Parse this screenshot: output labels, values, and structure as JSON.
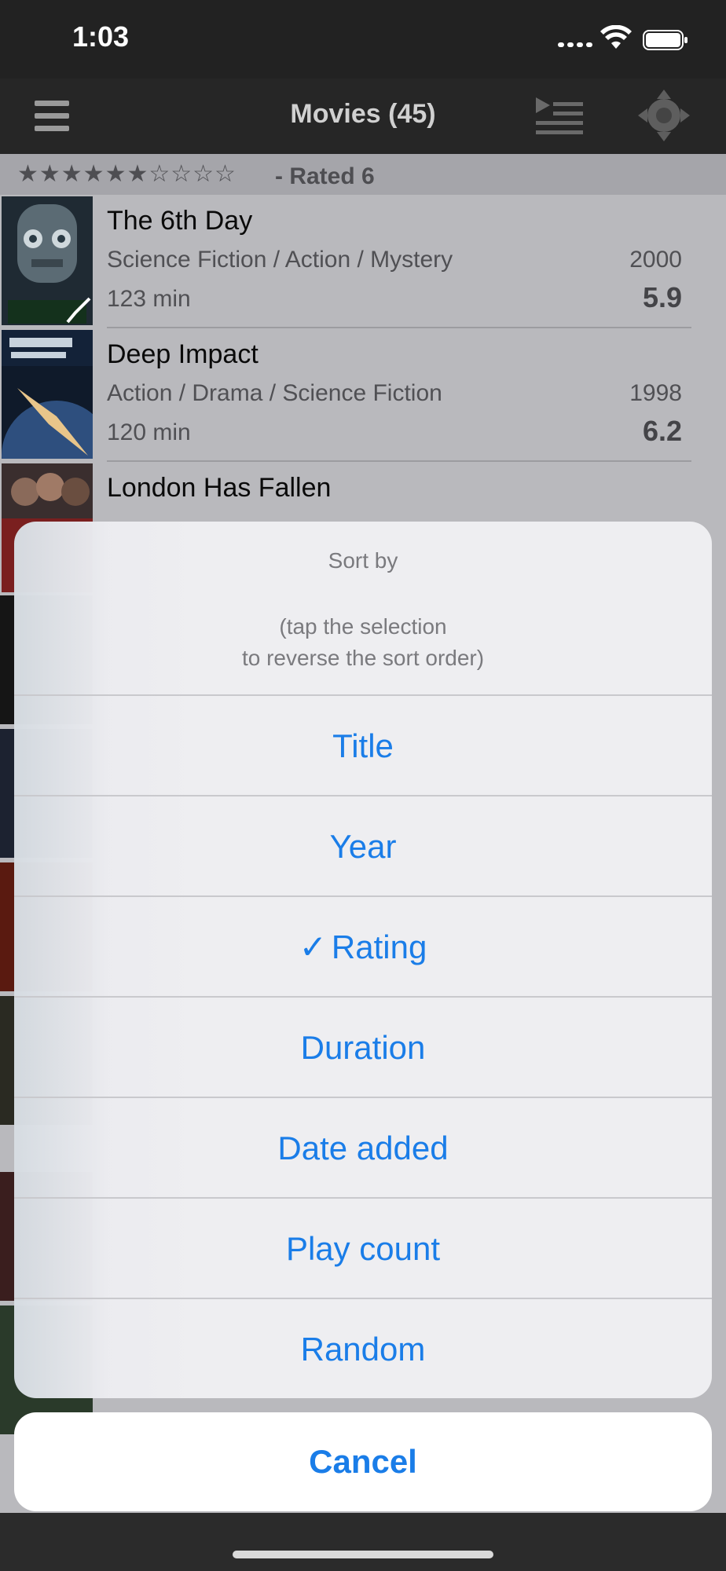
{
  "status_bar": {
    "time": "1:03"
  },
  "nav": {
    "title": "Movies (45)",
    "icons": [
      "menu-icon",
      "playlist-icon",
      "remote-icon"
    ]
  },
  "list": {
    "section": {
      "stars": "★★★★★★☆☆☆☆",
      "label": "- Rated 6"
    },
    "movies": [
      {
        "title": "The 6th Day",
        "genre": "Science Fiction / Action / Mystery",
        "year": "2000",
        "runtime": "123 min",
        "rating": "5.9",
        "watched": true
      },
      {
        "title": "Deep Impact",
        "genre": "Action / Drama / Science Fiction",
        "year": "1998",
        "runtime": "120 min",
        "rating": "6.2",
        "watched": false
      },
      {
        "title": "London Has Fallen",
        "watched": false
      }
    ]
  },
  "sheet": {
    "title": "Sort by",
    "message_line1": "(tap the selection",
    "message_line2": "to reverse the sort order)",
    "options": [
      {
        "label": "Title",
        "selected": false
      },
      {
        "label": "Year",
        "selected": false
      },
      {
        "label": "Rating",
        "selected": true
      },
      {
        "label": "Duration",
        "selected": false
      },
      {
        "label": "Date added",
        "selected": false
      },
      {
        "label": "Play count",
        "selected": false
      },
      {
        "label": "Random",
        "selected": false
      }
    ],
    "selected_mark": "✓",
    "cancel": "Cancel"
  },
  "colors": {
    "accent": "#1a7de8",
    "sheet_bg": "#eeeef1",
    "list_bg": "#b9b9bd",
    "bar_bg": "#262626"
  }
}
